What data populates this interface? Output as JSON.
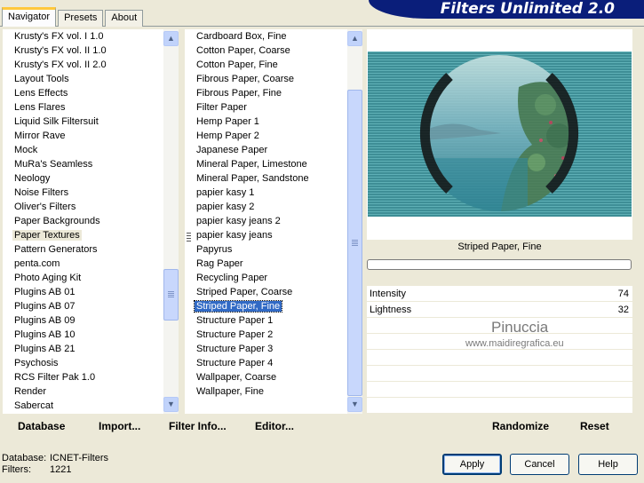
{
  "tabs": [
    "Navigator",
    "Presets",
    "About"
  ],
  "brand_title": "Filters Unlimited 2.0",
  "categories": [
    "Krusty's FX vol. I 1.0",
    "Krusty's FX vol. II 1.0",
    "Krusty's FX vol. II 2.0",
    "Layout Tools",
    "Lens Effects",
    "Lens Flares",
    "Liquid Silk Filtersuit",
    "Mirror Rave",
    "Mock",
    "MuRa's Seamless",
    "Neology",
    "Noise Filters",
    "Oliver's Filters",
    "Paper Backgrounds",
    "Paper Textures",
    "Pattern Generators",
    "penta.com",
    "Photo Aging Kit",
    "Plugins AB 01",
    "Plugins AB 07",
    "Plugins AB 09",
    "Plugins AB 10",
    "Plugins AB 21",
    "Psychosis",
    "RCS Filter Pak 1.0",
    "Render",
    "Sabercat"
  ],
  "selected_category": "Paper Textures",
  "filters": [
    "Cardboard Box, Fine",
    "Cotton Paper, Coarse",
    "Cotton Paper, Fine",
    "Fibrous Paper, Coarse",
    "Fibrous Paper, Fine",
    "Filter Paper",
    "Hemp Paper 1",
    "Hemp Paper 2",
    "Japanese Paper",
    "Mineral Paper, Limestone",
    "Mineral Paper, Sandstone",
    "papier kasy 1",
    "papier kasy 2",
    "papier kasy jeans 2",
    "papier kasy jeans",
    "Papyrus",
    "Rag Paper",
    "Recycling Paper",
    "Striped Paper, Coarse",
    "Striped Paper, Fine",
    "Structure Paper 1",
    "Structure Paper 2",
    "Structure Paper 3",
    "Structure Paper 4",
    "Wallpaper, Coarse",
    "Wallpaper, Fine"
  ],
  "selected_filter": "Striped Paper, Fine",
  "preview": {
    "filter_name": "Striped Paper, Fine",
    "progress": 0
  },
  "params": [
    {
      "label": "Intensity",
      "value": "74"
    },
    {
      "label": "Lightness",
      "value": "32"
    }
  ],
  "watermark": {
    "line1": "Pinuccia",
    "line2": "www.maidiregrafica.eu"
  },
  "toolbar": {
    "database": "Database",
    "import": "Import...",
    "filter_info": "Filter Info...",
    "editor": "Editor...",
    "randomize": "Randomize",
    "reset": "Reset"
  },
  "buttons": {
    "apply": "Apply",
    "cancel": "Cancel",
    "help": "Help"
  },
  "status": {
    "database_label": "Database:",
    "database_value": "ICNET-Filters",
    "filters_label": "Filters:",
    "filters_value": "1221"
  },
  "colors": {
    "selection": "#316ac5",
    "brand_bg": "#0a1e7a",
    "dialog_bg": "#ece9d8"
  },
  "icons": [
    "scroll-up-arrow-icon",
    "scroll-down-arrow-icon"
  ]
}
